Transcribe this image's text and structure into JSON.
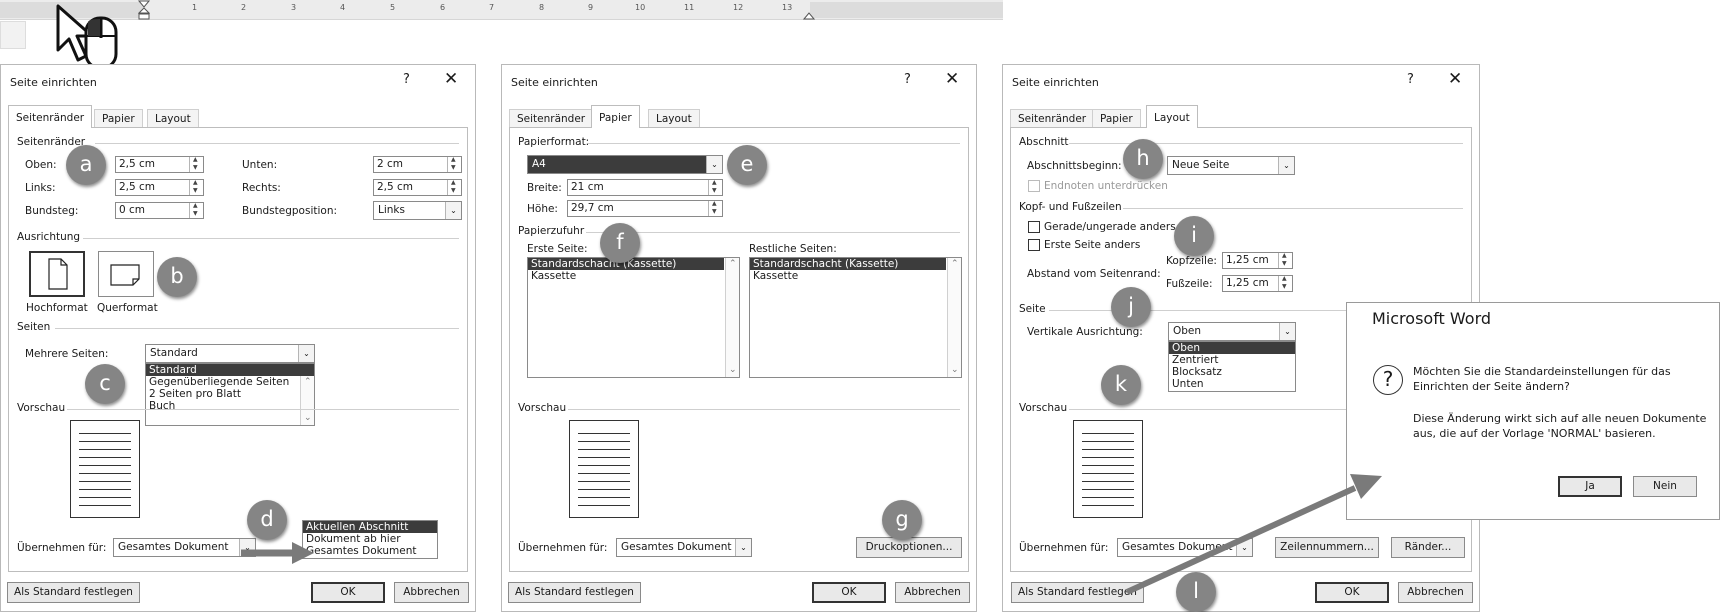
{
  "ruler": {
    "ticks": [
      "1",
      "2",
      "3",
      "4",
      "5",
      "6",
      "7",
      "8",
      "9",
      "10",
      "11",
      "12",
      "13"
    ]
  },
  "dialogs": [
    {
      "title": "Seite einrichten",
      "help": "?",
      "close": "✕",
      "tabs": [
        "Seitenränder",
        "Papier",
        "Layout"
      ],
      "margins_section": "Seitenränder",
      "oben_label": "Oben:",
      "oben_value": "2,5 cm",
      "unten_label": "Unten:",
      "unten_value": "2 cm",
      "links_label": "Links:",
      "links_value": "2,5 cm",
      "rechts_label": "Rechts:",
      "rechts_value": "2,5 cm",
      "bundsteg_label": "Bundsteg:",
      "bundsteg_value": "0 cm",
      "bundstegpos_label": "Bundstegposition:",
      "bundstegpos_value": "Links",
      "ausrichtung_section": "Ausrichtung",
      "hochformat": "Hochformat",
      "querformat": "Querformat",
      "seiten_section": "Seiten",
      "mehrere_label": "Mehrere Seiten:",
      "mehrere_value": "Standard",
      "mehrere_options": [
        "Standard",
        "Gegenüberliegende Seiten",
        "2 Seiten pro Blatt",
        "Buch"
      ],
      "vorschau": "Vorschau",
      "apply_label": "Übernehmen für:",
      "apply_value": "Gesamtes Dokument",
      "apply_options": [
        "Aktuellen Abschnitt",
        "Dokument ab hier",
        "Gesamtes Dokument"
      ],
      "default_btn": "Als Standard festlegen",
      "ok": "OK",
      "cancel": "Abbrechen"
    },
    {
      "title": "Seite einrichten",
      "help": "?",
      "close": "✕",
      "tabs": [
        "Seitenränder",
        "Papier",
        "Layout"
      ],
      "papierformat_section": "Papierformat:",
      "format_value": "A4",
      "breite_label": "Breite:",
      "breite_value": "21 cm",
      "hoehe_label": "Höhe:",
      "hoehe_value": "29,7 cm",
      "zufuhr_section": "Papierzufuhr",
      "erste_label": "Erste Seite:",
      "restliche_label": "Restliche Seiten:",
      "trays": [
        "Standardschacht (Kassette)",
        "Kassette"
      ],
      "vorschau": "Vorschau",
      "apply_label": "Übernehmen für:",
      "apply_value": "Gesamtes Dokument",
      "druck_btn": "Druckoptionen...",
      "default_btn": "Als Standard festlegen",
      "ok": "OK",
      "cancel": "Abbrechen"
    },
    {
      "title": "Seite einrichten",
      "help": "?",
      "close": "✕",
      "tabs": [
        "Seitenränder",
        "Papier",
        "Layout"
      ],
      "abschnitt_section": "Abschnitt",
      "beginn_label": "Abschnittsbeginn:",
      "beginn_value": "Neue Seite",
      "endnoten_label": "Endnoten unterdrücken",
      "kopf_section": "Kopf- und Fußzeilen",
      "gerade_label": "Gerade/ungerade anders",
      "erste_label": "Erste Seite anders",
      "abstand_label": "Abstand vom Seitenrand:",
      "kopfzeile_label": "Kopfzeile:",
      "kopfzeile_value": "1,25 cm",
      "fusszeile_label": "Fußzeile:",
      "fusszeile_value": "1,25 cm",
      "seite_section": "Seite",
      "vertikal_label": "Vertikale Ausrichtung:",
      "vertikal_value": "Oben",
      "vertikal_options": [
        "Oben",
        "Zentriert",
        "Blocksatz",
        "Unten"
      ],
      "vorschau": "Vorschau",
      "apply_label": "Übernehmen für:",
      "apply_value": "Gesamtes Dokument",
      "zeilen_btn": "Zeilennummern...",
      "raender_btn": "Ränder...",
      "default_btn": "Als Standard festlegen",
      "ok": "OK",
      "cancel": "Abbrechen"
    }
  ],
  "msgbox": {
    "title": "Microsoft Word",
    "icon": "?",
    "line1": "Möchten Sie die Standardeinstellungen für das",
    "line2": "Einrichten der Seite ändern?",
    "line3": "Diese Änderung wirkt sich auf alle neuen Dokumente",
    "line4": "aus, die auf der Vorlage 'NORMAL' basieren.",
    "ja": "Ja",
    "nein": "Nein"
  },
  "badges": [
    "a",
    "b",
    "c",
    "d",
    "e",
    "f",
    "g",
    "h",
    "i",
    "j",
    "k",
    "l"
  ]
}
